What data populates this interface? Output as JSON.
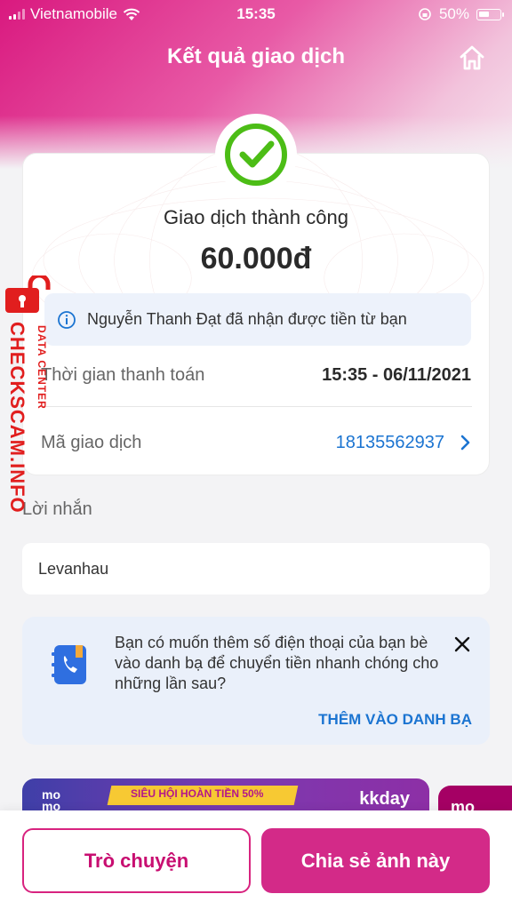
{
  "status_bar": {
    "carrier": "Vietnamobile",
    "time": "15:35",
    "battery": "50%"
  },
  "header": {
    "title": "Kết quả giao dịch",
    "home_icon": "home-icon"
  },
  "result": {
    "status_text": "Giao dịch thành công",
    "amount": "60.000đ",
    "info_message": "Nguyễn Thanh Đạt đã nhận được tiền từ bạn",
    "payment_time_label": "Thời gian thanh toán",
    "payment_time_value": "15:35 - 06/11/2021",
    "transaction_id_label": "Mã giao dịch",
    "transaction_id_value": "18135562937"
  },
  "note": {
    "label": "Lời nhắn",
    "value": "Levanhau"
  },
  "contact_prompt": {
    "message": "Bạn có muốn thêm số điện thoại của bạn bè vào danh bạ để chuyển tiền nhanh chóng cho những lần sau?",
    "action": "THÊM VÀO DANH BẠ"
  },
  "banner": {
    "logo_line1": "mo",
    "logo_line2": "mo",
    "ribbon_text": "SIÊU HỘI HOÀN TIỀN 50%",
    "brand": "kkday",
    "second_logo": "mo"
  },
  "actions": {
    "chat": "Trò chuyện",
    "share": "Chia sẻ ảnh này"
  },
  "watermark": {
    "main": "CHECKSCAM.INFO",
    "sub": "DATA CENTER"
  },
  "colors": {
    "brand_pink": "#d32a88",
    "link_blue": "#1b74d1",
    "success_green": "#4cbd16",
    "watermark_red": "#e11e1e"
  }
}
